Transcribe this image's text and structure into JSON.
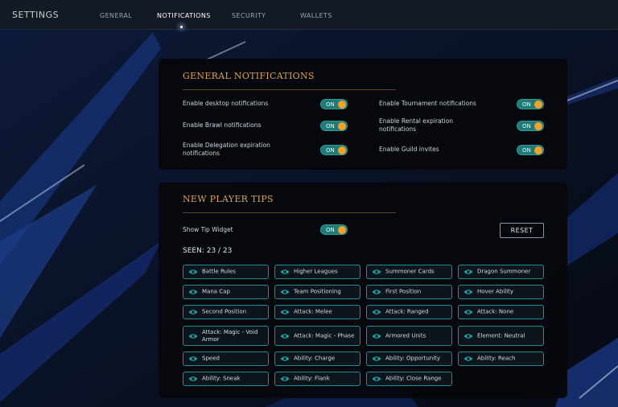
{
  "header": {
    "title": "SETTINGS",
    "tabs": [
      {
        "label": "GENERAL",
        "active": false
      },
      {
        "label": "NOTIFICATIONS",
        "active": true
      },
      {
        "label": "SECURITY",
        "active": false
      },
      {
        "label": "WALLETS",
        "active": false
      }
    ]
  },
  "general_notifications": {
    "heading": "GENERAL NOTIFICATIONS",
    "items": [
      {
        "label": "Enable desktop notifications",
        "toggle": "ON"
      },
      {
        "label": "Enable Brawl notifications",
        "toggle": "ON"
      },
      {
        "label": "Enable Delegation expiration notifications",
        "toggle": "ON"
      },
      {
        "label": "Enable Tournament notifications",
        "toggle": "ON"
      },
      {
        "label": "Enable Rental expiration notifications",
        "toggle": "ON"
      },
      {
        "label": "Enable Guild invites",
        "toggle": "ON"
      }
    ]
  },
  "new_player_tips": {
    "heading": "NEW PLAYER TIPS",
    "show_tip_label": "Show Tip Widget",
    "show_tip_toggle": "ON",
    "reset_label": "RESET",
    "seen_label": "SEEN: 23 / 23",
    "tips": [
      "Battle Rules",
      "Higher Leagues",
      "Summoner Cards",
      "Dragon Summoner",
      "Mana Cap",
      "Team Positioning",
      "First Position",
      "Hover Ability",
      "Second Position",
      "Attack: Melee",
      "Attack: Ranged",
      "Attack: None",
      "Attack: Magic - Void Armor",
      "Attack: Magic - Phase",
      "Armored Units",
      "Element: Neutral",
      "Speed",
      "Ability: Charge",
      "Ability: Opportunity",
      "Ability: Reach",
      "Ability: Sneak",
      "Ability: Flank",
      "Ability: Close Range"
    ]
  },
  "colors": {
    "accent_gold": "#d8a35c",
    "toggle_on": "#1f7a78",
    "toggle_knob": "#f2a229",
    "tip_border": "#1f8f95"
  },
  "icons": {
    "tip_icon": "eye-icon"
  }
}
